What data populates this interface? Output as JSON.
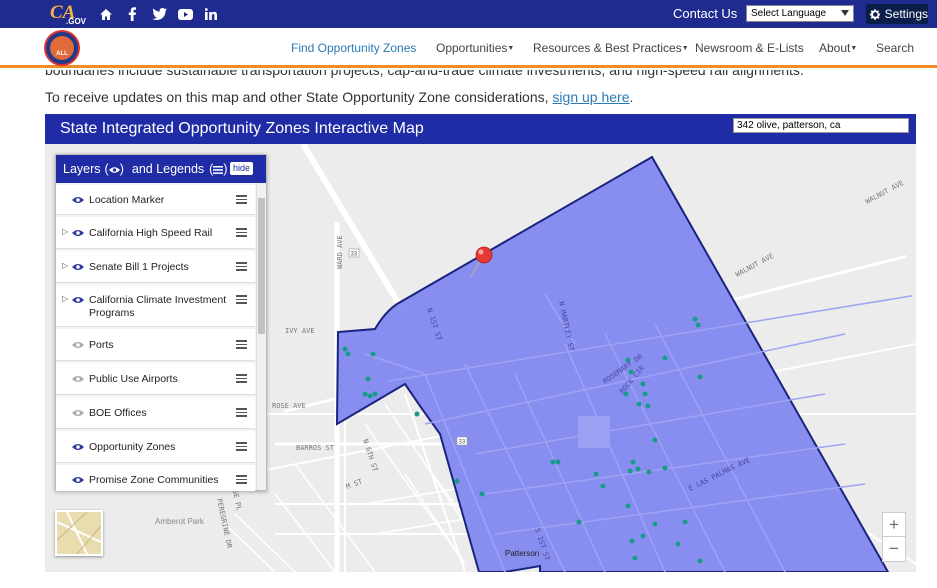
{
  "topbar": {
    "logo_text": "CA",
    "logo_sub": ".GOV",
    "contact": "Contact Us",
    "language": "Select Language",
    "settings": "Settings",
    "social_icons": [
      "home-icon",
      "facebook-icon",
      "twitter-icon",
      "youtube-icon",
      "linkedin-icon"
    ]
  },
  "nav": {
    "seal_text": "ALL",
    "items": [
      {
        "label": "Find Opportunity Zones",
        "active": true
      },
      {
        "label": "Opportunities",
        "dropdown": true
      },
      {
        "label": "Resources & Best Practices",
        "dropdown": true
      },
      {
        "label": "Newsroom & E-Lists"
      },
      {
        "label": "About",
        "dropdown": true
      },
      {
        "label": "Search"
      }
    ]
  },
  "content": {
    "partial_text": "boundaries include sustainable transportation projects, cap-and-trade climate investments, and high-speed rail alignments.",
    "updates_before": "To receive updates on this map and other State Opportunity Zone considerations, ",
    "updates_link": "sign up here",
    "updates_after": "."
  },
  "map": {
    "title": "State Integrated Opportunity Zones Interactive Map",
    "search_value": "342 olive, patterson, ca",
    "layers_panel": {
      "title": "Layers",
      "title_and": "and Legends",
      "hide_label": "hide",
      "layers": [
        {
          "label": "Location Marker",
          "expandable": false,
          "visible": true
        },
        {
          "label": "California High Speed Rail",
          "expandable": true,
          "visible": true
        },
        {
          "label": "Senate Bill 1 Projects",
          "expandable": true,
          "visible": true
        },
        {
          "label": "California Climate Investment Programs",
          "expandable": true,
          "visible": true
        },
        {
          "label": "Ports",
          "expandable": false,
          "visible": false
        },
        {
          "label": "Public Use Airports",
          "expandable": false,
          "visible": false
        },
        {
          "label": "BOE Offices",
          "expandable": false,
          "visible": false
        },
        {
          "label": "Opportunity Zones",
          "expandable": false,
          "visible": true
        },
        {
          "label": "Promise Zone Communities",
          "expandable": false,
          "visible": true
        }
      ]
    },
    "street_labels": [
      "WARD AVE",
      "IVY AVE",
      "ROSE AVE",
      "BARROS ST",
      "WALNUT AVE",
      "WALNUT AVE",
      "N 1ST ST",
      "N HARTLEY ST",
      "ROSEMARY DR",
      "ROCK CIR",
      "E LAS PALMAS AVE",
      "N 6TH ST",
      "M ST",
      "S 1ST ST",
      "ROSE PL",
      "PEREGRINE DR",
      "Amberot Park",
      "Patterson",
      "33"
    ],
    "colors": {
      "zone_fill": "#7f86f0",
      "zone_border": "#1a237e",
      "marker": "#e53935",
      "project_pin": "#1a9b8a",
      "header": "#1f2ca6"
    }
  }
}
